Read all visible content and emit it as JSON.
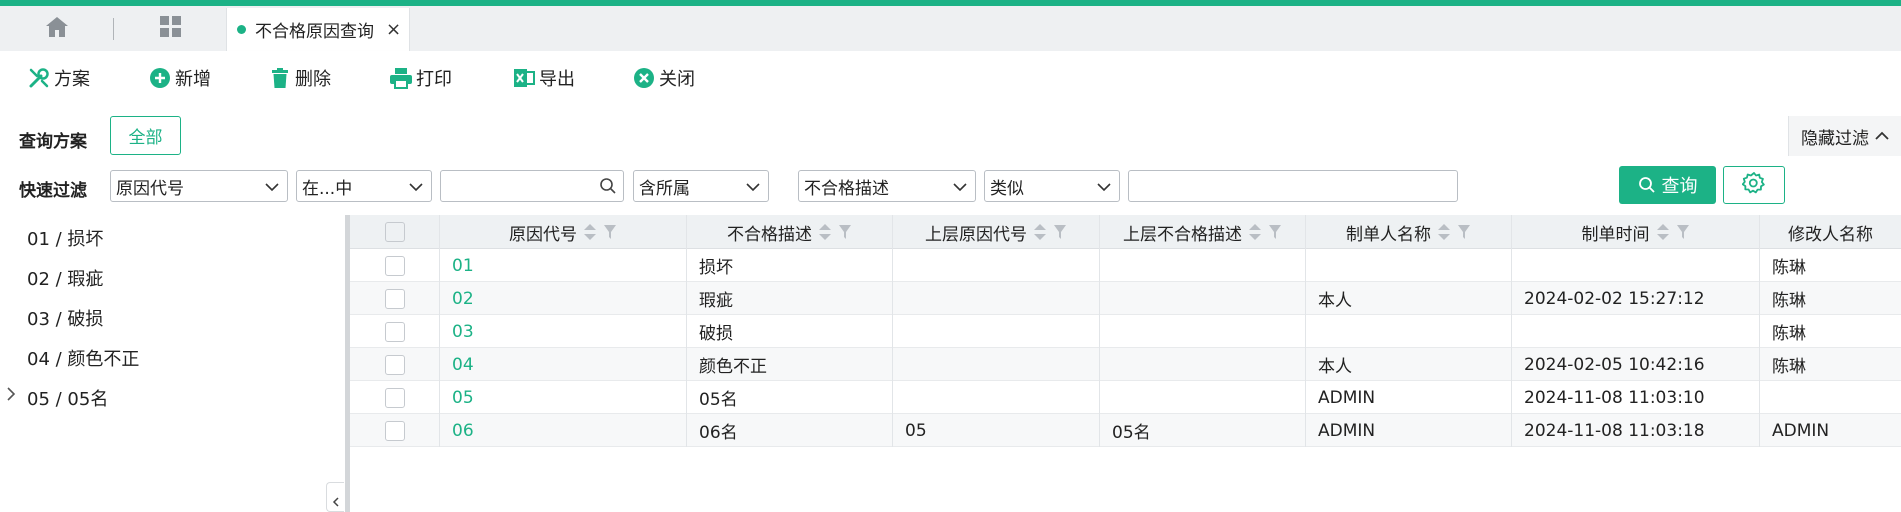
{
  "tabs": {
    "active_title": "不合格原因查询",
    "close_glyph": "×"
  },
  "toolbar": {
    "items": [
      {
        "label": "方案",
        "icon": "scheme-tools-icon"
      },
      {
        "label": "新增",
        "icon": "plus-circle-icon"
      },
      {
        "label": "删除",
        "icon": "trash-icon"
      },
      {
        "label": "打印",
        "icon": "printer-icon"
      },
      {
        "label": "导出",
        "icon": "excel-export-icon"
      },
      {
        "label": "关闭",
        "icon": "close-circle-icon"
      }
    ]
  },
  "filters": {
    "scheme_label": "查询方案",
    "scheme_all": "全部",
    "hide_filter": "隐藏过滤",
    "quick_label": "快速过滤",
    "field1": "原因代号",
    "op1": "在...中",
    "value1": "",
    "scope": "含所属",
    "field2": "不合格描述",
    "op2": "类似",
    "value2": "",
    "query_label": "查询"
  },
  "tree": {
    "items": [
      {
        "label": "01 / 损坏",
        "expandable": false
      },
      {
        "label": "02 / 瑕疵",
        "expandable": false
      },
      {
        "label": "03 / 破损",
        "expandable": false
      },
      {
        "label": "04 / 颜色不正",
        "expandable": false
      },
      {
        "label": "05 / 05名",
        "expandable": true
      }
    ]
  },
  "grid": {
    "columns": [
      "原因代号",
      "不合格描述",
      "上层原因代号",
      "上层不合格描述",
      "制单人名称",
      "制单时间",
      "修改人名称"
    ],
    "rows": [
      [
        "01",
        "损坏",
        "",
        "",
        "",
        "",
        "陈琳"
      ],
      [
        "02",
        "瑕疵",
        "",
        "",
        "本人",
        "2024-02-02 15:27:12",
        "陈琳"
      ],
      [
        "03",
        "破损",
        "",
        "",
        "",
        "",
        "陈琳"
      ],
      [
        "04",
        "颜色不正",
        "",
        "",
        "本人",
        "2024-02-05 10:42:16",
        "陈琳"
      ],
      [
        "05",
        "05名",
        "",
        "",
        "ADMIN",
        "2024-11-08 11:03:10",
        ""
      ],
      [
        "06",
        "06名",
        "05",
        "05名",
        "ADMIN",
        "2024-11-08 11:03:18",
        "ADMIN"
      ]
    ]
  },
  "colors": {
    "accent": "#1cb286",
    "header_bg": "#eef1f3",
    "tab_strip_bg": "#eef0f2"
  }
}
